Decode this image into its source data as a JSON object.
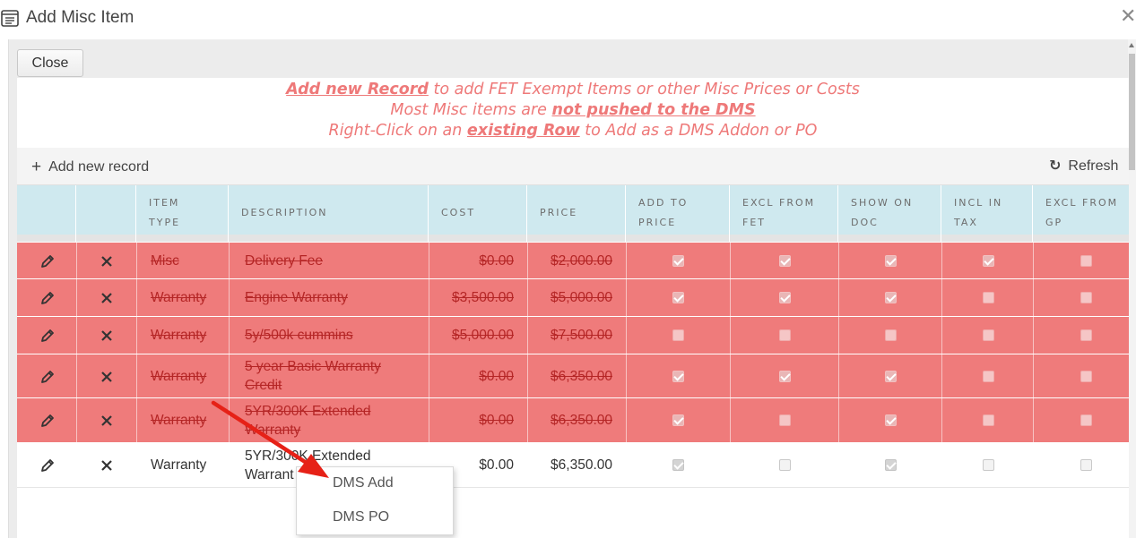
{
  "window": {
    "title": "Add Misc Item",
    "close_glyph": "✕",
    "title_icon": "form-icon"
  },
  "toolbar": {
    "close_label": "Close",
    "add_record_label": "Add new record",
    "add_record_icon": "plus-icon",
    "refresh_label": "Refresh",
    "refresh_icon": "refresh-icon"
  },
  "notice": {
    "line1_link": "Add new Record",
    "line1_rest": " to add FET Exempt Items or other Misc Prices or Costs",
    "line2_pre": "Most Misc items are ",
    "line2_u": "not pushed to the DMS",
    "line3_pre": "Right-Click on an ",
    "line3_u": "existing Row",
    "line3_rest": " to Add as a DMS Addon or PO",
    "color": "#ee7979"
  },
  "grid": {
    "columns": [
      {
        "key": "edit",
        "line1": "",
        "line2": ""
      },
      {
        "key": "delete",
        "line1": "",
        "line2": ""
      },
      {
        "key": "item_type",
        "line1": "ITEM",
        "line2": "TYPE"
      },
      {
        "key": "description",
        "line1": "DESCRIPTION",
        "line2": ""
      },
      {
        "key": "cost",
        "line1": "COST",
        "line2": ""
      },
      {
        "key": "price",
        "line1": "PRICE",
        "line2": ""
      },
      {
        "key": "add_to_price",
        "line1": "ADD TO",
        "line2": "PRICE"
      },
      {
        "key": "excl_from_fet",
        "line1": "EXCL FROM",
        "line2": "FET"
      },
      {
        "key": "show_on_doc",
        "line1": "SHOW ON",
        "line2": "DOC"
      },
      {
        "key": "incl_in_tax",
        "line1": "INCL IN",
        "line2": "TAX"
      },
      {
        "key": "excl_from_gp",
        "line1": "EXCL FROM",
        "line2": "GP"
      }
    ],
    "rows": [
      {
        "deleted": true,
        "item_type": "Misc",
        "desc1": "Delivery Fee",
        "desc2": "",
        "cost": "$0.00",
        "price": "$2,000.00",
        "checks": [
          true,
          true,
          true,
          true,
          false
        ]
      },
      {
        "deleted": true,
        "item_type": "Warranty",
        "desc1": "Engine Warranty",
        "desc2": "",
        "cost": "$3,500.00",
        "price": "$5,000.00",
        "checks": [
          true,
          true,
          true,
          false,
          false
        ]
      },
      {
        "deleted": true,
        "item_type": "Warranty",
        "desc1": "5y/500k cummins",
        "desc2": "",
        "cost": "$5,000.00",
        "price": "$7,500.00",
        "checks": [
          false,
          false,
          false,
          false,
          false
        ]
      },
      {
        "deleted": true,
        "item_type": "Warranty",
        "desc1": "5 year Basic Warranty",
        "desc2": "Credit",
        "cost": "$0.00",
        "price": "$6,350.00",
        "checks": [
          true,
          true,
          true,
          false,
          false
        ]
      },
      {
        "deleted": true,
        "item_type": "Warranty",
        "desc1": "5YR/300K Extended",
        "desc2": "Warranty",
        "cost": "$0.00",
        "price": "$6,350.00",
        "checks": [
          true,
          false,
          true,
          false,
          false
        ]
      },
      {
        "deleted": false,
        "item_type": "Warranty",
        "desc1": "5YR/300K Extended",
        "desc2": "Warrant",
        "cost": "$0.00",
        "price": "$6,350.00",
        "checks": [
          true,
          false,
          true,
          false,
          false
        ]
      }
    ],
    "deleted_row_color": "#ef7b7b",
    "header_color": "#cfe9ef"
  },
  "context_menu": {
    "items": [
      "DMS Add",
      "DMS PO"
    ]
  },
  "annotation": {
    "arrow_color": "#e62117",
    "arrow_icon": "red-arrow-annotation"
  }
}
